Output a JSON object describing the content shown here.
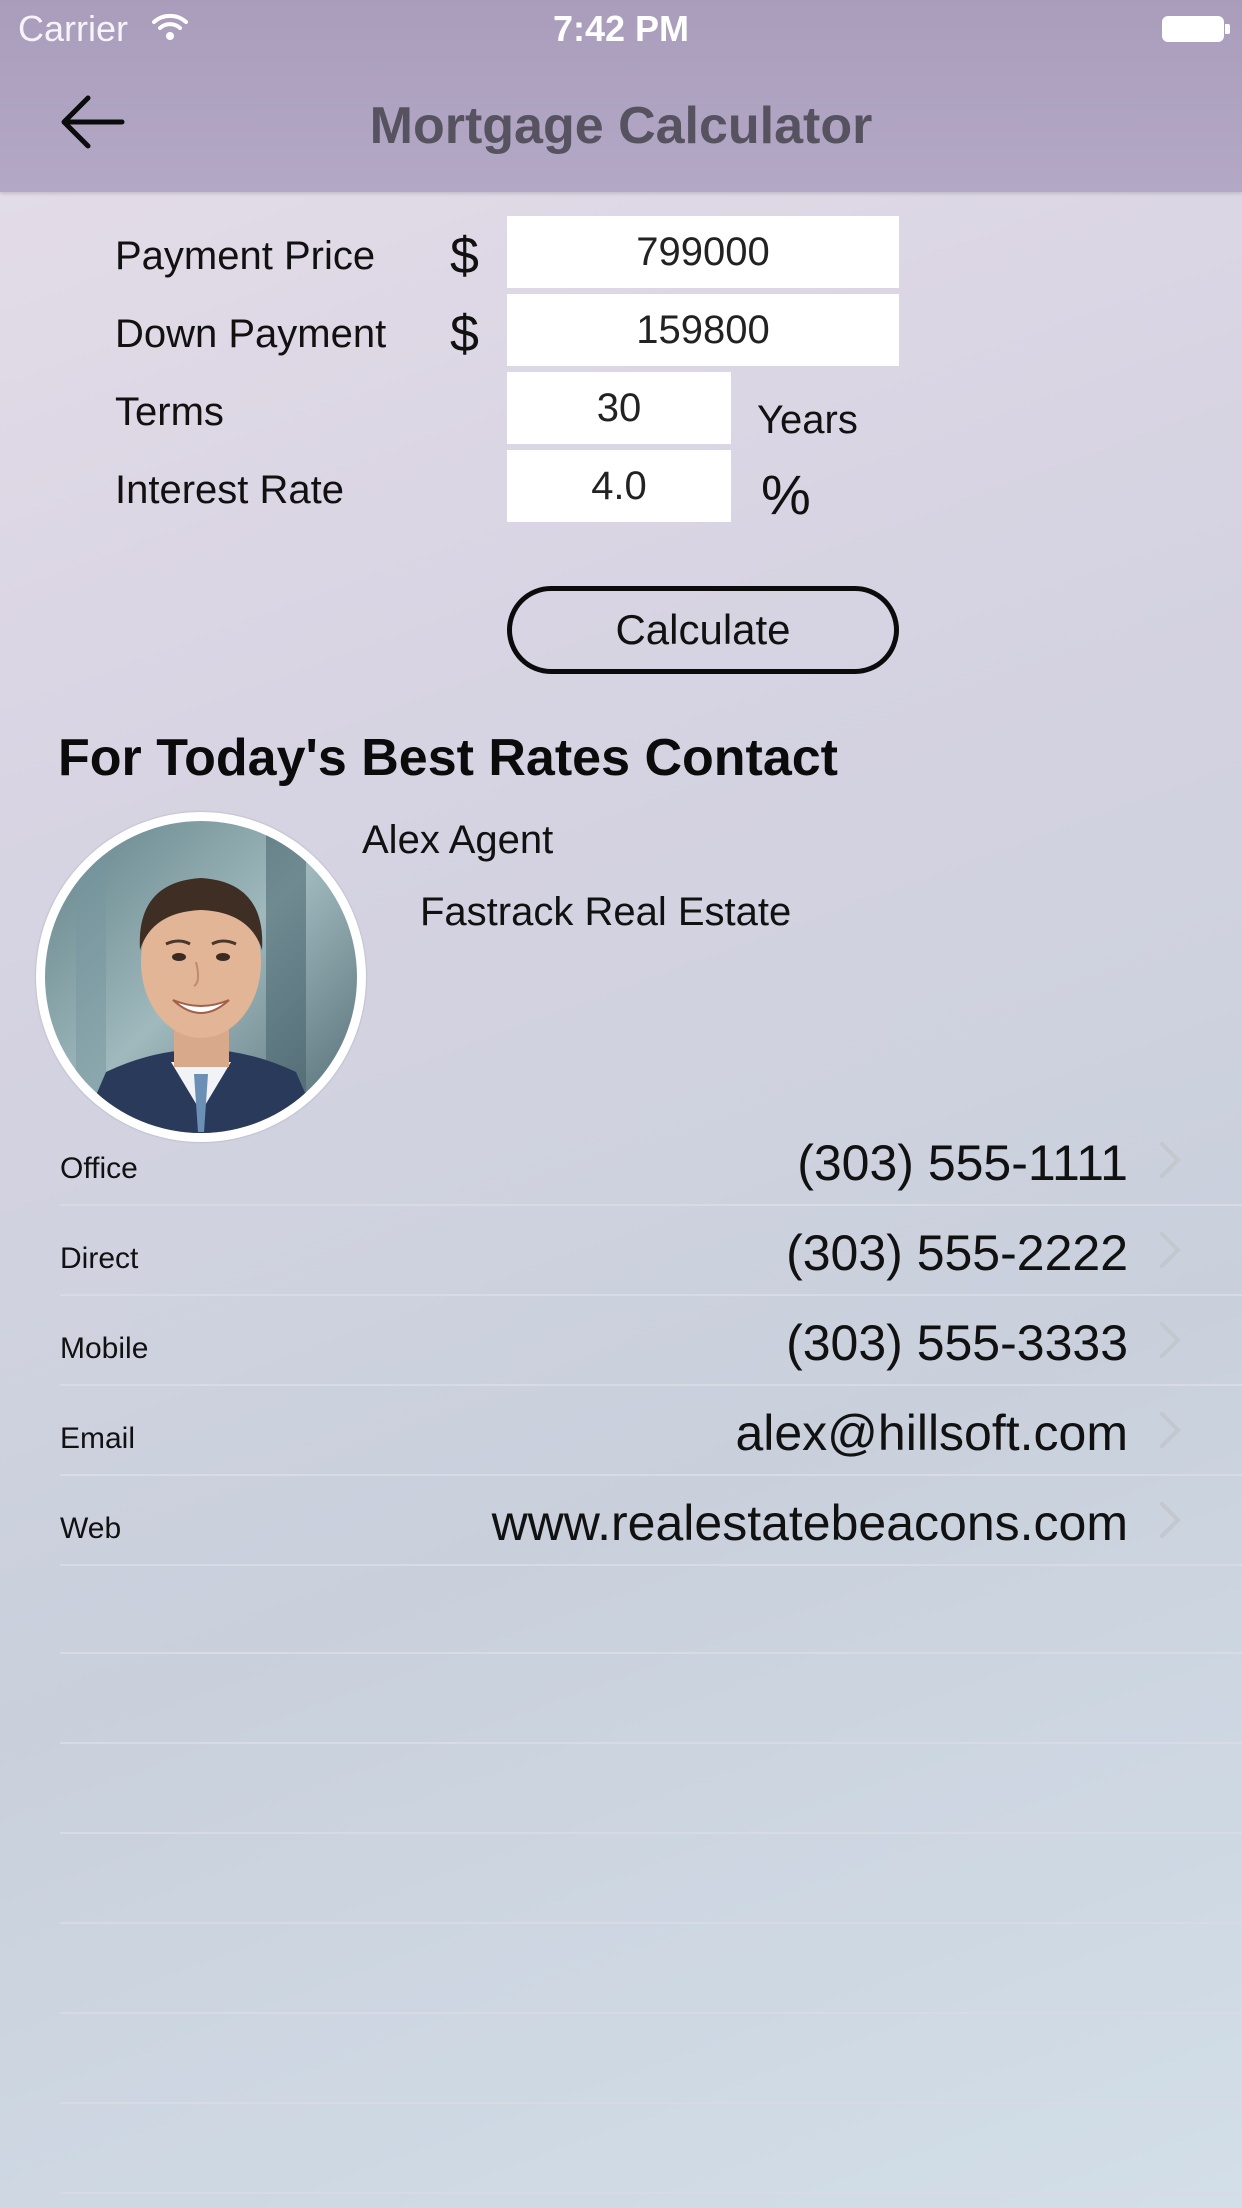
{
  "status_bar": {
    "carrier": "Carrier",
    "time": "7:42 PM"
  },
  "nav": {
    "title": "Mortgage Calculator",
    "back_icon": "arrow-left-icon"
  },
  "form": {
    "payment_price": {
      "label": "Payment Price",
      "currency": "$",
      "value": "799000"
    },
    "down_payment": {
      "label": "Down Payment",
      "currency": "$",
      "value": "159800"
    },
    "terms": {
      "label": "Terms",
      "value": "30",
      "unit": "Years"
    },
    "interest_rate": {
      "label": "Interest Rate",
      "value": "4.0",
      "unit": "%"
    },
    "calculate_label": "Calculate"
  },
  "contact": {
    "heading": "For Today's Best Rates Contact",
    "name": "Alex Agent",
    "company": "Fastrack Real Estate",
    "rows": [
      {
        "label": "Office",
        "value": "(303) 555-1111"
      },
      {
        "label": "Direct",
        "value": "(303) 555-2222"
      },
      {
        "label": "Mobile",
        "value": "(303) 555-3333"
      },
      {
        "label": "Email",
        "value": "alex@hillsoft.com"
      },
      {
        "label": "Web",
        "value": "www.realestatebeacons.com"
      }
    ]
  },
  "colors": {
    "nav_bar": "#ab9fbd",
    "nav_title": "#575260",
    "separator": "#d8dbe3"
  }
}
